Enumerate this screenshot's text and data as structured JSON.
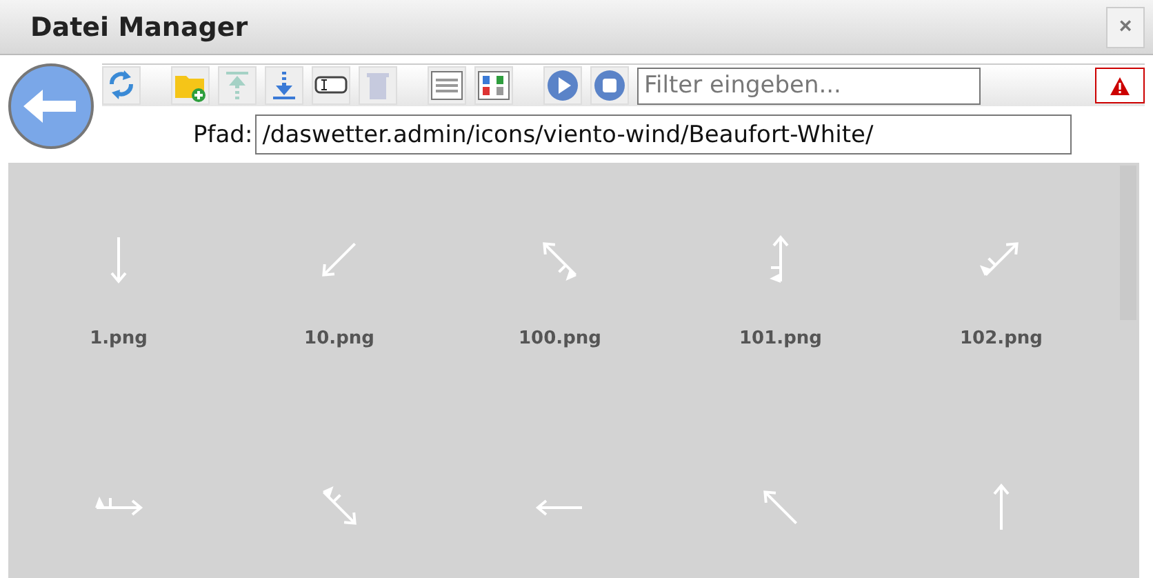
{
  "window": {
    "title": "Datei Manager",
    "close": "×"
  },
  "toolbar": {
    "buttons": [
      {
        "kind": "refresh",
        "disabled": false
      },
      {
        "kind": "newfolder",
        "disabled": false
      },
      {
        "kind": "upload",
        "disabled": true
      },
      {
        "kind": "download",
        "disabled": false
      },
      {
        "kind": "rename",
        "disabled": false
      },
      {
        "kind": "delete",
        "disabled": true
      },
      {
        "kind": "listview",
        "disabled": false
      },
      {
        "kind": "tileview",
        "disabled": false
      },
      {
        "kind": "play",
        "disabled": false
      },
      {
        "kind": "stop",
        "disabled": false
      }
    ],
    "filter": {
      "placeholder": "Filter eingeben..."
    }
  },
  "path": {
    "label": "Pfad:",
    "value": "/daswetter.admin/icons/viento-wind/Beaufort-White/"
  },
  "files": [
    {
      "name": "1.png",
      "kind": "s"
    },
    {
      "name": "10.png",
      "kind": "sw"
    },
    {
      "name": "100.png",
      "kind": "nwflag"
    },
    {
      "name": "101.png",
      "kind": "nflag"
    },
    {
      "name": "102.png",
      "kind": "neflag"
    },
    {
      "kind": "eflag"
    },
    {
      "kind": "seflag"
    },
    {
      "kind": "w"
    },
    {
      "kind": "nw"
    },
    {
      "kind": "n"
    }
  ]
}
